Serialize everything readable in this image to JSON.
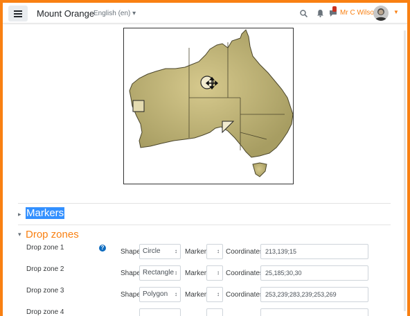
{
  "navbar": {
    "menu_icon": "hamburger-icon",
    "site_name": "Mount Orange",
    "language": "English (en)",
    "search_icon": "search-icon",
    "notifications_icon": "bell-icon",
    "messages_icon": "chat-icon",
    "user_name": "Mr C Wilson",
    "accent_color": "#f98012"
  },
  "sections": {
    "markers": {
      "label": "Markers",
      "expanded": false
    },
    "drop_zones": {
      "label": "Drop zones",
      "expanded": true
    }
  },
  "labels": {
    "shape": "Shape",
    "marker": "Marker",
    "coordinates": "Coordinates"
  },
  "drop_zones": [
    {
      "label": "Drop zone 1",
      "shape": "Circle",
      "marker": "",
      "coordinates": "213,139;15"
    },
    {
      "label": "Drop zone 2",
      "shape": "Rectangle",
      "marker": "",
      "coordinates": "25,185;30,30"
    },
    {
      "label": "Drop zone 3",
      "shape": "Polygon",
      "marker": "",
      "coordinates": "253,239;283,239;253,269"
    },
    {
      "label": "Drop zone 4",
      "shape": "",
      "marker": "",
      "coordinates": ""
    }
  ]
}
